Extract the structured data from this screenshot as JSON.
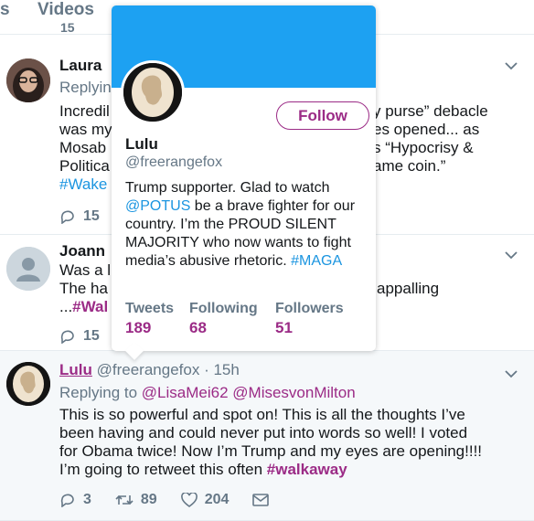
{
  "tabs": {
    "top_partial": "s",
    "videos": "Videos"
  },
  "partial_stat": "15",
  "tweets": [
    {
      "name_partial": "Laura",
      "reply_partial": "Replyin",
      "lines_left": [
        "Incredil",
        "was my",
        "Mosab",
        "Politica"
      ],
      "lines_right": [
        "y purse” debacle",
        "es opened... as",
        "s “Hypocrisy &",
        "ame coin.”"
      ],
      "hashtag_partial": "#Wake",
      "reply_count": "15"
    },
    {
      "name_partial": "Joann",
      "lines_left": [
        "Was a l",
        "The ha"
      ],
      "line_right": "appalling",
      "hashtag_prefix": "...",
      "hashtag_partial": "#Wal",
      "reply_count": "15"
    },
    {
      "name": "Lulu",
      "handle": "@freerangefox",
      "time": "· 15h",
      "reply_prefix": "Replying to",
      "reply_users": [
        "@LisaMei62",
        "@MisesvonMilton"
      ],
      "text_lines": [
        "This is so powerful and spot on! This is all the thoughts I’ve",
        "been having and could never put into words so well! I voted",
        "for Obama twice! Now I’m Trump and my eyes are opening!!!!",
        "I’m going to retweet this often"
      ],
      "hashtag": "#walkaway",
      "reply_count": "3",
      "retweet_count": "89",
      "like_count": "204"
    }
  ],
  "profile_card": {
    "name": "Lulu",
    "handle": "@freerangefox",
    "follow_label": "Follow",
    "bio": [
      {
        "t": "Trump supporter. Glad to watch "
      },
      {
        "t": "@POTUS",
        "link": true
      },
      {
        "t": " be a brave fighter for our country. I’m the PROUD SILENT MAJORITY who now wants to fight media’s abusive rhetoric. "
      },
      {
        "t": "#MAGA",
        "link": true
      }
    ],
    "stats": [
      {
        "label": "Tweets",
        "value": "189"
      },
      {
        "label": "Following",
        "value": "68"
      },
      {
        "label": "Followers",
        "value": "51"
      }
    ]
  },
  "colors": {
    "accent": "#9b2b86",
    "link": "#1b95e0",
    "banner": "#1da1f2",
    "muted": "#657786"
  }
}
